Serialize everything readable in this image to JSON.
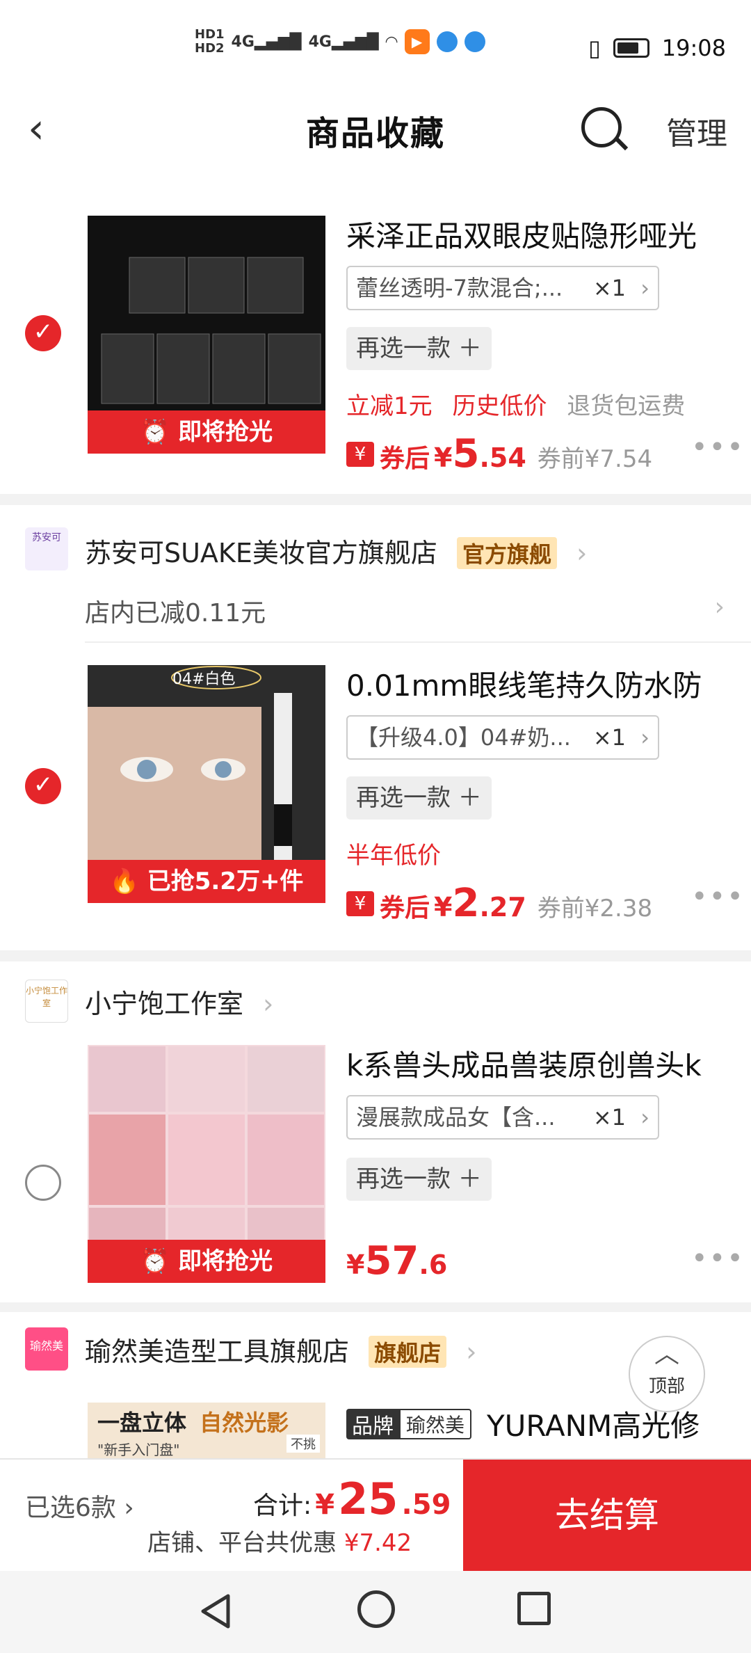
{
  "status_bar": {
    "hd1": "HD1",
    "hd2": "HD2",
    "net1": "4G",
    "net2": "4G",
    "time": "19:08"
  },
  "nav": {
    "title": "商品收藏",
    "manage": "管理"
  },
  "items": [
    {
      "title": "采泽正品双眼皮贴隐形哑光",
      "sku": "蕾丝透明-7款混合;...",
      "qty": "×1",
      "reselect": "再选一款 ＋",
      "thumb_label": "⏰ 即将抢光",
      "tags": [
        "立减1元",
        "历史低价"
      ],
      "tag_gray": "退货包运费",
      "coupon_icon": "¥",
      "price_prefix": "券后",
      "yen": "¥",
      "price_int": "5",
      "price_dec": ".54",
      "price_before": "券前¥7.54"
    },
    {
      "title": "0.01mm眼线笔持久防水防",
      "sku": "【升级4.0】04#奶...",
      "qty": "×1",
      "reselect": "再选一款 ＋",
      "thumb_label": "🔥 已抢5.2万+件",
      "thumb_overlay": "04#白色",
      "tags": [
        "半年低价"
      ],
      "coupon_icon": "¥",
      "price_prefix": "券后",
      "yen": "¥",
      "price_int": "2",
      "price_dec": ".27",
      "price_before": "券前¥2.38"
    },
    {
      "title": "k系兽头成品兽装原创兽头k",
      "sku": "漫展款成品女【含...",
      "qty": "×1",
      "reselect": "再选一款 ＋",
      "thumb_label": "⏰ 即将抢光",
      "yen": "¥",
      "price_int": "57",
      "price_dec": ".6"
    }
  ],
  "shops": {
    "shop1": {
      "logo": "苏安可",
      "name": "苏安可SUAKE美妆官方旗舰店",
      "badge": "官方旗舰",
      "discount": "店内已减0.11元"
    },
    "shop2": {
      "logo": "小宁饱工作室",
      "name": "小宁饱工作室"
    },
    "shop3": {
      "logo": "瑜然美",
      "name": "瑜然美造型工具旗舰店",
      "badge": "旗舰店",
      "brand_tag": "品牌",
      "brand_name": "瑜然美",
      "item_title": "YURANM高光修",
      "thumb_text1": "一盘立体",
      "thumb_text2": "自然光影",
      "thumb_text3": "\"新手入门盘\"",
      "thumb_text4": "不挑"
    }
  },
  "scroll_top": {
    "label": "顶部"
  },
  "bottom": {
    "selected": "已选6款 ›",
    "total_label": "合计:",
    "yen": "¥",
    "total_int": "25",
    "total_dec": ".59",
    "savings_label": "店铺、平台共优惠",
    "savings_amount": "¥7.42",
    "checkout": "去结算"
  },
  "colors": {
    "accent": "#e5262a",
    "badge_bg": "#ffe5b4"
  }
}
